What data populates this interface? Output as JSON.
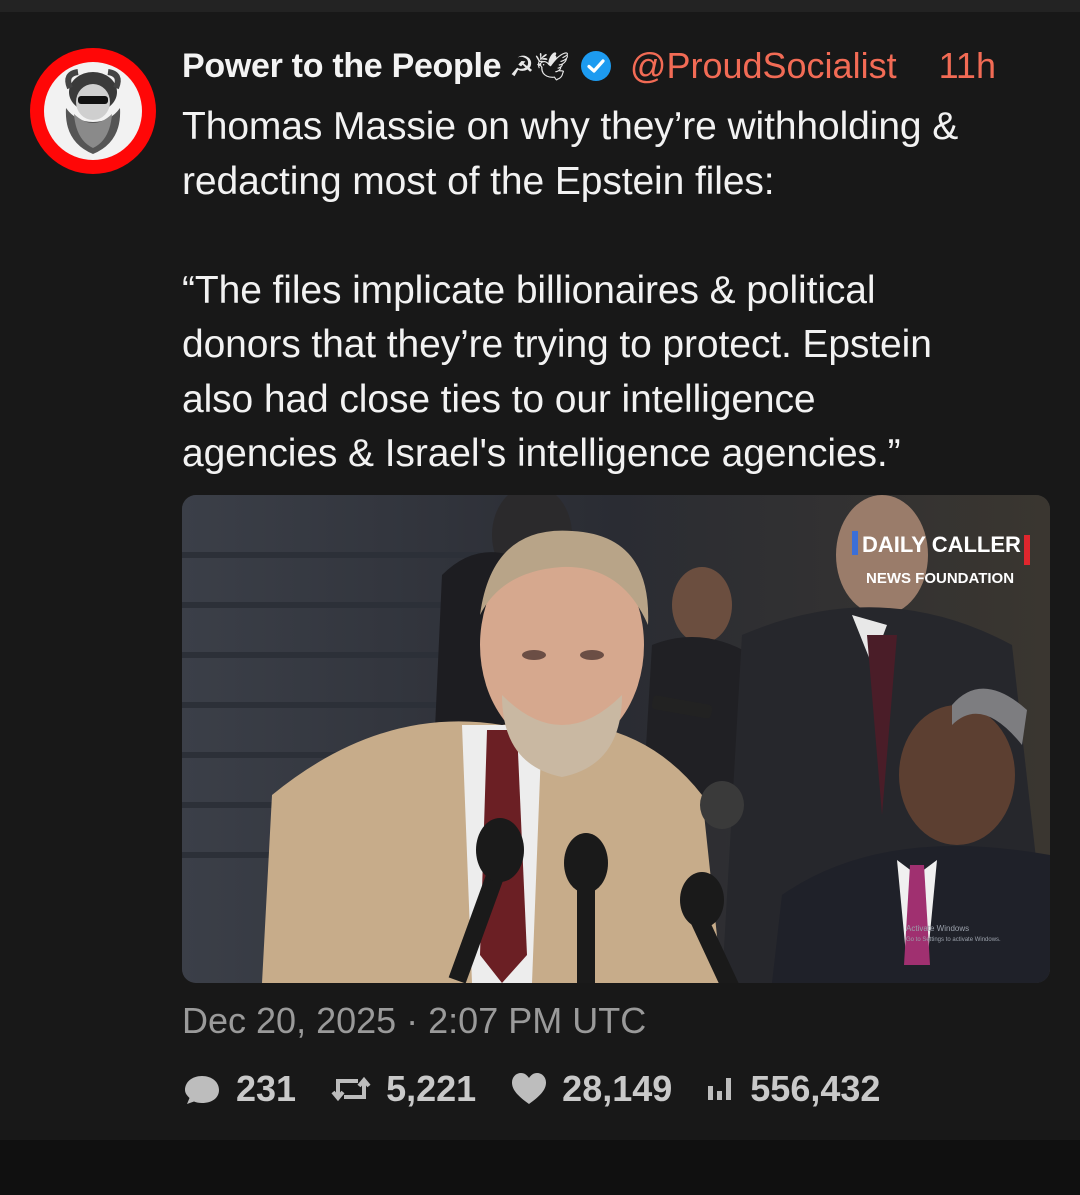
{
  "author": {
    "display_name": "Power to the People",
    "name_emojis": "☭🕊",
    "handle": "@ProudSocialist",
    "time_ago": "11h",
    "verified": true
  },
  "tweet": {
    "text": "Thomas Massie on why they’re withholding &\nredacting most of the Epstein files:\n\n“The files implicate billionaires & political\ndonors that they’re trying to protect. Epstein\nalso had close ties to our intelligence\nagencies & Israel's intelligence agencies.”"
  },
  "media": {
    "watermark_line1": "DAILY CALLER",
    "watermark_line2": "NEWS FOUNDATION",
    "system_overlay_line1": "Activate Windows",
    "system_overlay_line2": "Go to Settings to activate Windows."
  },
  "timestamp": "Dec 20, 2025 · 2:07 PM UTC",
  "stats": {
    "replies": "231",
    "retweets": "5,221",
    "likes": "28,149",
    "views": "556,432"
  },
  "colors": {
    "background": "#181818",
    "accent": "#f26b55",
    "verified": "#1d9bf0",
    "avatar_ring": "#ff0707"
  },
  "icons": [
    "verified-badge-icon",
    "reply-icon",
    "retweet-icon",
    "like-icon",
    "views-icon"
  ]
}
